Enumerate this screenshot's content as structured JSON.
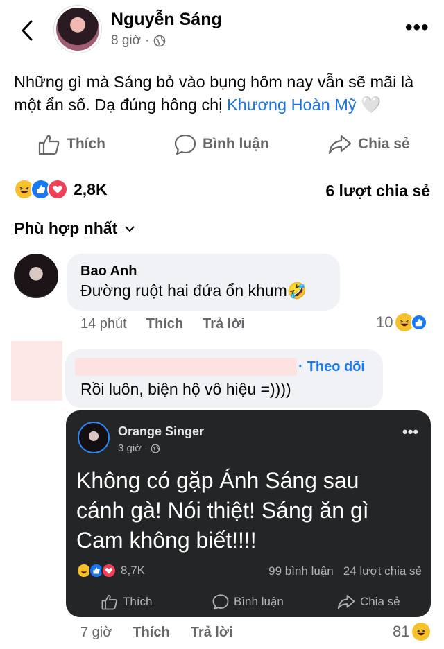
{
  "header": {
    "author": "Nguyễn Sáng",
    "time": "8 giờ",
    "separator": "·",
    "more": "•••"
  },
  "post": {
    "text_before": "Những gì mà Sáng bỏ vào bụng hôm nay vẫn sẽ mãi là một ẩn số. Dạ đúng hông chị ",
    "mention": "Khương Hoàn Mỹ",
    "heart": "🤍"
  },
  "actions": {
    "like": "Thích",
    "comment": "Bình luận",
    "share": "Chia sẻ"
  },
  "summary": {
    "reaction_count": "2,8K",
    "share_count": "6 lượt chia sẻ"
  },
  "sort": {
    "label": "Phù hợp nhất"
  },
  "comments": [
    {
      "name": "Bao Anh",
      "text": "Đường ruột hai đứa ổn khum🤣",
      "time": "14 phút",
      "like": "Thích",
      "reply": "Trả lời",
      "likes": "10"
    },
    {
      "follow": "Theo dõi",
      "separator": "·",
      "text": "Rồi luôn, biện hộ vô hiệu =))))",
      "time": "7 giờ",
      "like": "Thích",
      "reply": "Trả lời",
      "likes": "81"
    }
  ],
  "embedded_post": {
    "author": "Orange Singer",
    "time": "3 giờ",
    "separator": "·",
    "more": "•••",
    "text": "Không có gặp Ánh Sáng sau cánh gà! Nói thiệt! Sáng ăn gì Cam không biết!!!!",
    "reaction_count": "8,7K",
    "comments": "99 bình luận",
    "shares": "24 lượt chia sẻ",
    "like": "Thích",
    "comment": "Bình luận",
    "share": "Chia sẻ"
  },
  "colors": {
    "accent": "#1877f2",
    "mention": "#1b74e4",
    "secondary_text": "#65676b",
    "bubble": "#f0f2f5",
    "card_bg": "#242526"
  }
}
